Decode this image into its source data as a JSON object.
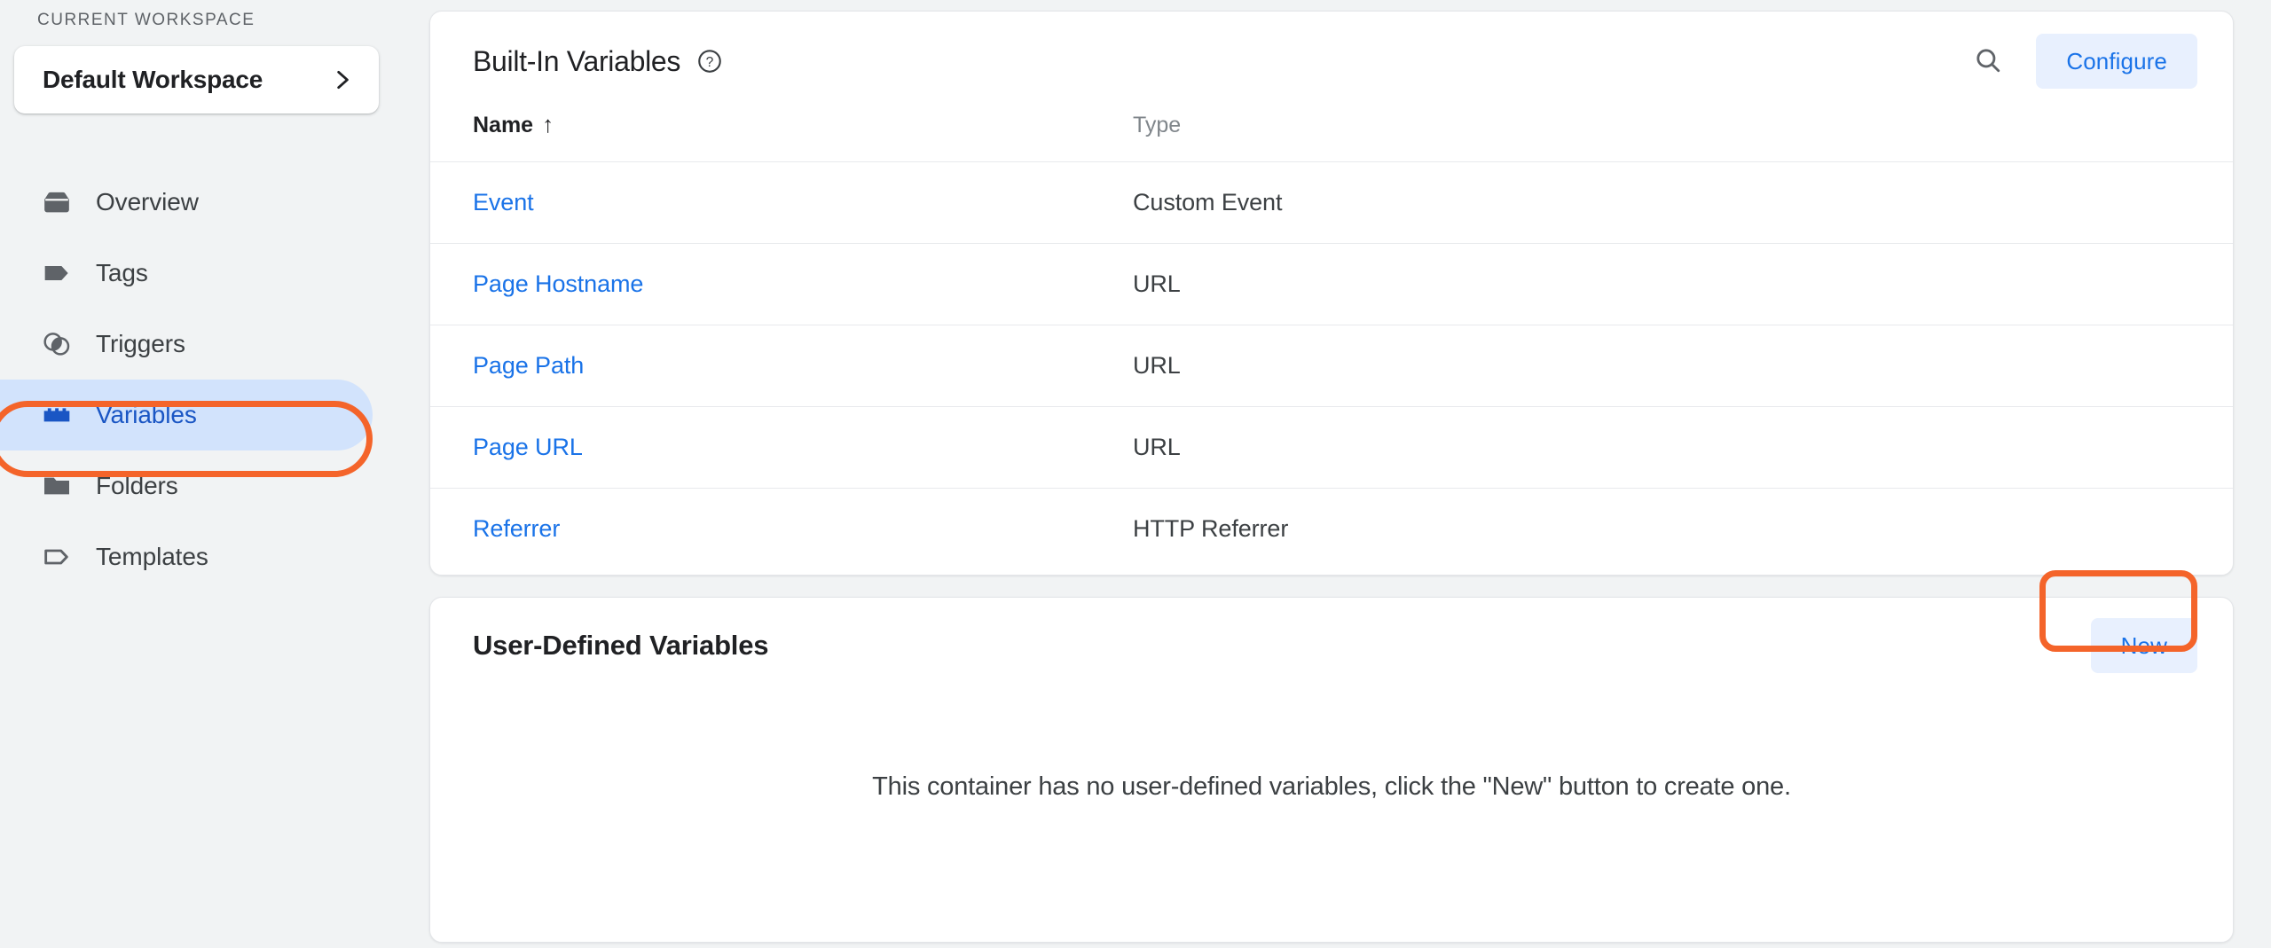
{
  "sidebar": {
    "workspace_section_label": "CURRENT WORKSPACE",
    "workspace_name": "Default Workspace",
    "chevron_icon": "chevron-right-icon",
    "items": [
      {
        "label": "Overview",
        "icon": "container-icon",
        "active": false
      },
      {
        "label": "Tags",
        "icon": "tag-filled-icon",
        "active": false
      },
      {
        "label": "Triggers",
        "icon": "triggers-icon",
        "active": false
      },
      {
        "label": "Variables",
        "icon": "brick-icon",
        "active": true
      },
      {
        "label": "Folders",
        "icon": "folder-icon",
        "active": false
      },
      {
        "label": "Templates",
        "icon": "tag-outline-icon",
        "active": false
      }
    ]
  },
  "built_in": {
    "title": "Built-In Variables",
    "help_icon": "help-circle-icon",
    "search_icon": "search-icon",
    "configure_label": "Configure",
    "columns": {
      "name": "Name",
      "sort_indicator": "↑",
      "type": "Type"
    },
    "rows": [
      {
        "name": "Event",
        "type": "Custom Event"
      },
      {
        "name": "Page Hostname",
        "type": "URL"
      },
      {
        "name": "Page Path",
        "type": "URL"
      },
      {
        "name": "Page URL",
        "type": "URL"
      },
      {
        "name": "Referrer",
        "type": "HTTP Referrer"
      }
    ]
  },
  "user_defined": {
    "title": "User-Defined Variables",
    "new_label": "New",
    "empty_message": "This container has no user-defined variables, click the \"New\" button to create one."
  },
  "colors": {
    "page_background": "#f1f3f4",
    "card_background": "#ffffff",
    "accent_blue": "#1a73e8",
    "tonal_button_bg": "#e8f0fe",
    "active_nav_bg": "#d2e3fc",
    "active_nav_text": "#1a56c4",
    "highlight_orange": "#f4642a",
    "icon_gray": "#5f6368",
    "text_primary": "#202124",
    "text_secondary": "#80868b"
  }
}
